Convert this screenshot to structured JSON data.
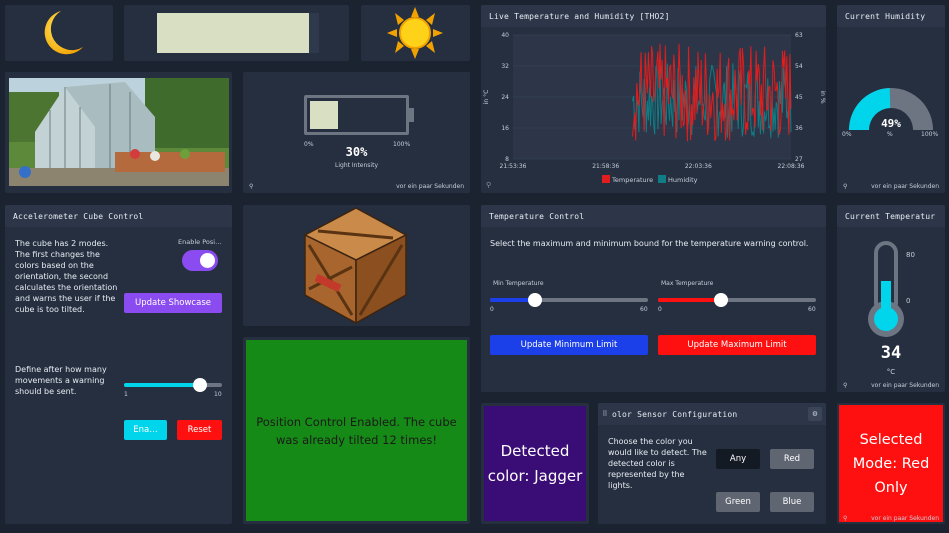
{
  "colors": {
    "background": "#1b2230",
    "widget": "#252f40",
    "header": "#2c3648",
    "temperature": "#e11d1d",
    "humidity": "#0f7d85",
    "accent_cyan": "#00d5ec",
    "purple": "#8a4cf0",
    "blue": "#1b3fe8",
    "red": "#ff1010",
    "green": "#168a16",
    "jagger": "#3a0c75"
  },
  "icons": [
    "moon-icon",
    "sun-icon",
    "battery-icon",
    "thermometer-icon",
    "crate-icon",
    "greenhouse-photo",
    "pin-icon",
    "gear-icon",
    "drag-handle-icon"
  ],
  "footer_time": "vor ein paar Sekunden",
  "light": {
    "percent_value": 30,
    "value_text": "30%",
    "label": "Light Intensity",
    "min": "0%",
    "max": "100%"
  },
  "live_chart": {
    "title": "Live Temperature and Humidity [THO2]",
    "legend_temperature": "Temperature",
    "legend_humidity": "Humidity"
  },
  "chart_data": {
    "type": "line",
    "x": [
      "21:53:36",
      "21:58:36",
      "22:03:36",
      "22:08:36"
    ],
    "ylabel_left": "in °C",
    "ylabel_right": "in %",
    "ylim_left": [
      8,
      40
    ],
    "ylim_right": [
      27,
      63
    ],
    "yticks_left": [
      8,
      16,
      24,
      32,
      40
    ],
    "yticks_right": [
      27,
      36,
      45,
      54,
      63
    ],
    "grid": true,
    "legend": "bottom",
    "series": [
      {
        "name": "Temperature",
        "axis": "left",
        "color": "#e11d1d",
        "range": [
          12,
          38
        ]
      },
      {
        "name": "Humidity",
        "axis": "right",
        "color": "#0f7d85",
        "range": [
          33,
          55
        ]
      }
    ]
  },
  "humidity": {
    "title": "Current Humidity",
    "value_percent": 49,
    "value_text": "49%",
    "unit": "%",
    "min": "0%",
    "max": "100%"
  },
  "accelerometer": {
    "title": "Accelerometer Cube Control",
    "description": "The cube has 2 modes. The first changes the colors based on the orientation, the second calculates the orientation and warns the user if the cube is too tilted.",
    "toggle_label": "Enable Posi…",
    "toggle_on": true,
    "showcase_button": "Update Showcase",
    "warning_text": "Define after how many movements a warning should be sent.",
    "slider_min": "1",
    "slider_max": "10",
    "slider_value": 8,
    "enable_button": "Ena…",
    "reset_button": "Reset"
  },
  "position_status": "Position Control Enabled. The cube was already tilted 12 times!",
  "temperature_control": {
    "title": "Temperature Control",
    "description": "Select the maximum and minimum bound for the temperature warning control.",
    "min_label": "Min Temperature",
    "max_label": "Max Temperature",
    "min_scale": [
      "0",
      "60"
    ],
    "max_scale": [
      "0",
      "60"
    ],
    "min_value": 17,
    "max_value": 24,
    "min_button": "Update Minimum Limit",
    "max_button": "Update Maximum Limit"
  },
  "current_temperature": {
    "title": "Current Temperaturе",
    "title_visible": "Current Temperatur",
    "value": "34",
    "unit": "°C",
    "scale_top": "80",
    "scale_mid": "0"
  },
  "detected_color": {
    "text": "Detected color: Jagger"
  },
  "color_sensor": {
    "title": "olor Sensor Configuration",
    "description": "Choose the color you would like to detect. The detected color is represented by the lights.",
    "buttons": [
      "Any",
      "Red",
      "Green",
      "Blue"
    ]
  },
  "selected_mode": {
    "text": "Selected Mode: Red Only"
  }
}
